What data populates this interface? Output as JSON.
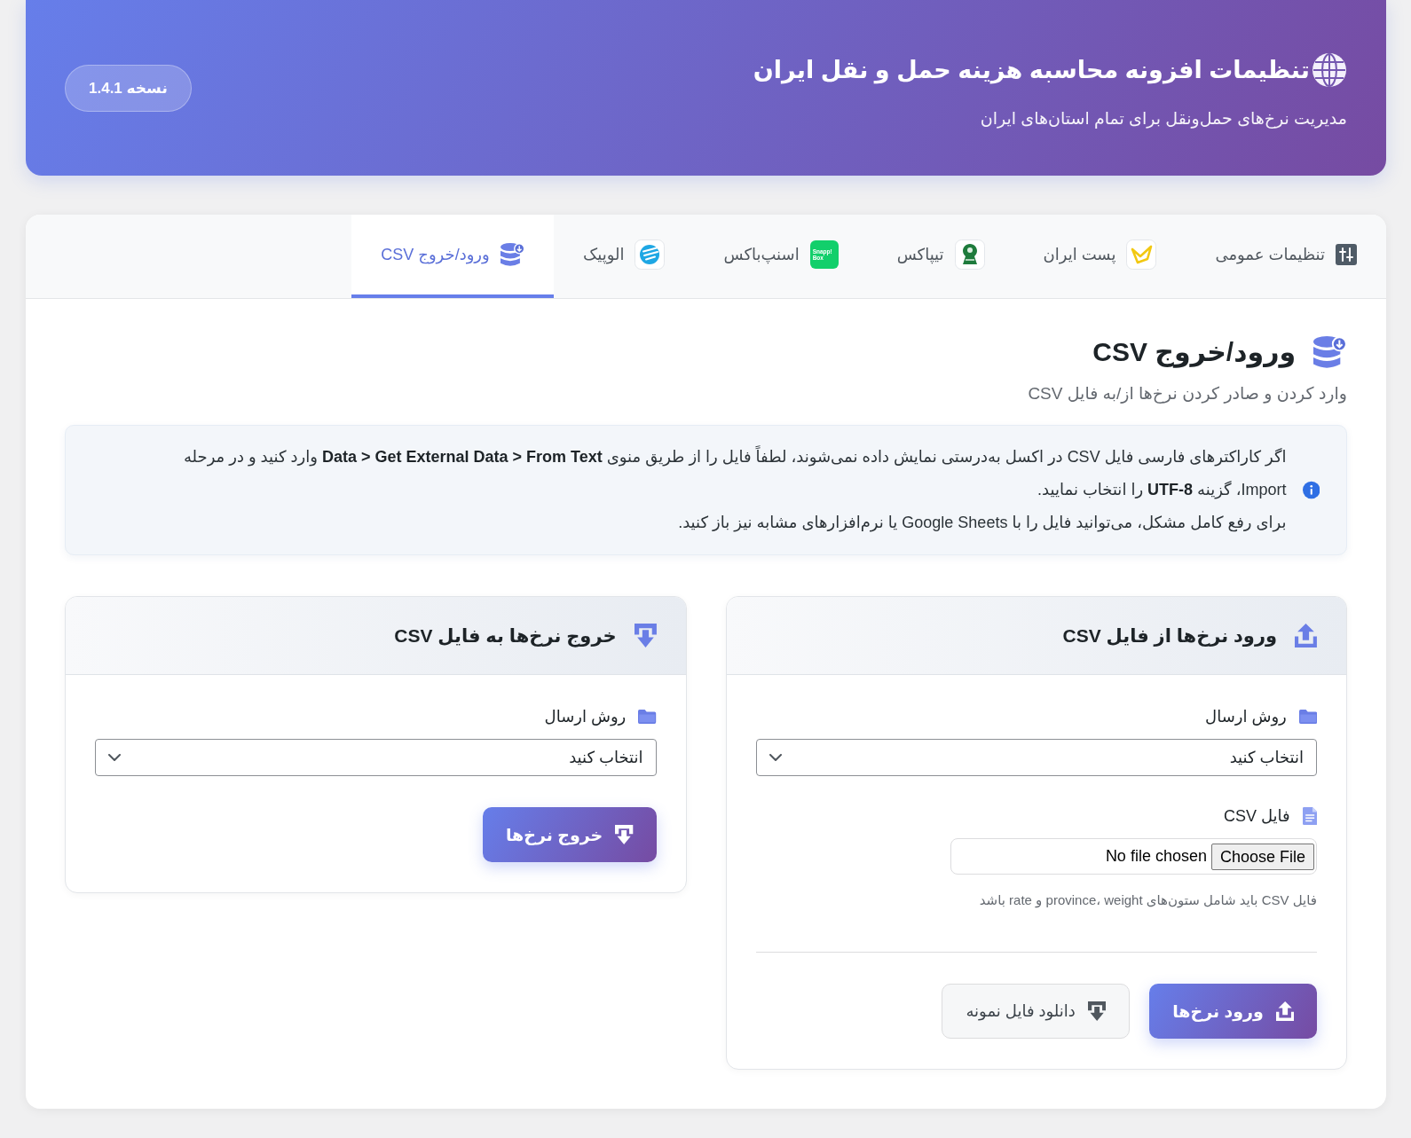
{
  "header": {
    "title": "تنظیمات افزونه محاسبه هزینه حمل و نقل ایران",
    "subtitle": "مدیریت نرخ‌های حمل‌ونقل برای تمام استان‌های ایران",
    "version": "نسخه 1.4.1"
  },
  "tabs": [
    {
      "label": "تنظیمات عمومی",
      "selected": false
    },
    {
      "label": "پست ایران",
      "selected": false
    },
    {
      "label": "تیپاکس",
      "selected": false
    },
    {
      "label": "اسنپ‌باکس",
      "selected": false,
      "logo_text": "Snapp! Box"
    },
    {
      "label": "الوپیک",
      "selected": false
    },
    {
      "label": "ورود/خروج CSV",
      "selected": true
    }
  ],
  "section": {
    "title": "ورود/خروج CSV",
    "subtitle": "وارد کردن و صادر کردن نرخ‌ها از/به فایل CSV"
  },
  "notice": {
    "paragraphs": [
      "اگر کاراکترهای فارسی فایل CSV در اکسل به‌درستی نمایش داده نمی‌شوند، لطفاً فایل را از طریق منوی **Data > Get External Data > From Text** وارد کنید و در مرحله Import، گزینه **UTF-8** را انتخاب نمایید.",
      "برای رفع کامل مشکل، می‌توانید فایل را با Google Sheets یا نرم‌افزارهای مشابه نیز باز کنید."
    ]
  },
  "cards": [
    {
      "kind": "import",
      "title": "ورود نرخ‌ها از فایل CSV",
      "fields": [
        {
          "kind": "select",
          "label": "روش ارسال",
          "value": "انتخاب کنید"
        },
        {
          "kind": "file",
          "label": "فایل CSV",
          "button": "Choose File",
          "status": "No file chosen",
          "hint": "فایل CSV باید شامل ستون‌های province، weight و rate باشد"
        }
      ],
      "buttons": [
        {
          "kind": "primary",
          "label": "ورود نرخ‌ها"
        },
        {
          "kind": "secondary",
          "label": "دانلود فایل نمونه"
        }
      ]
    },
    {
      "kind": "export",
      "title": "خروج نرخ‌ها به فایل CSV",
      "fields": [
        {
          "kind": "select",
          "label": "روش ارسال",
          "value": "انتخاب کنید"
        }
      ],
      "buttons": [
        {
          "kind": "primary",
          "label": "خروج نرخ‌ها"
        }
      ]
    }
  ]
}
